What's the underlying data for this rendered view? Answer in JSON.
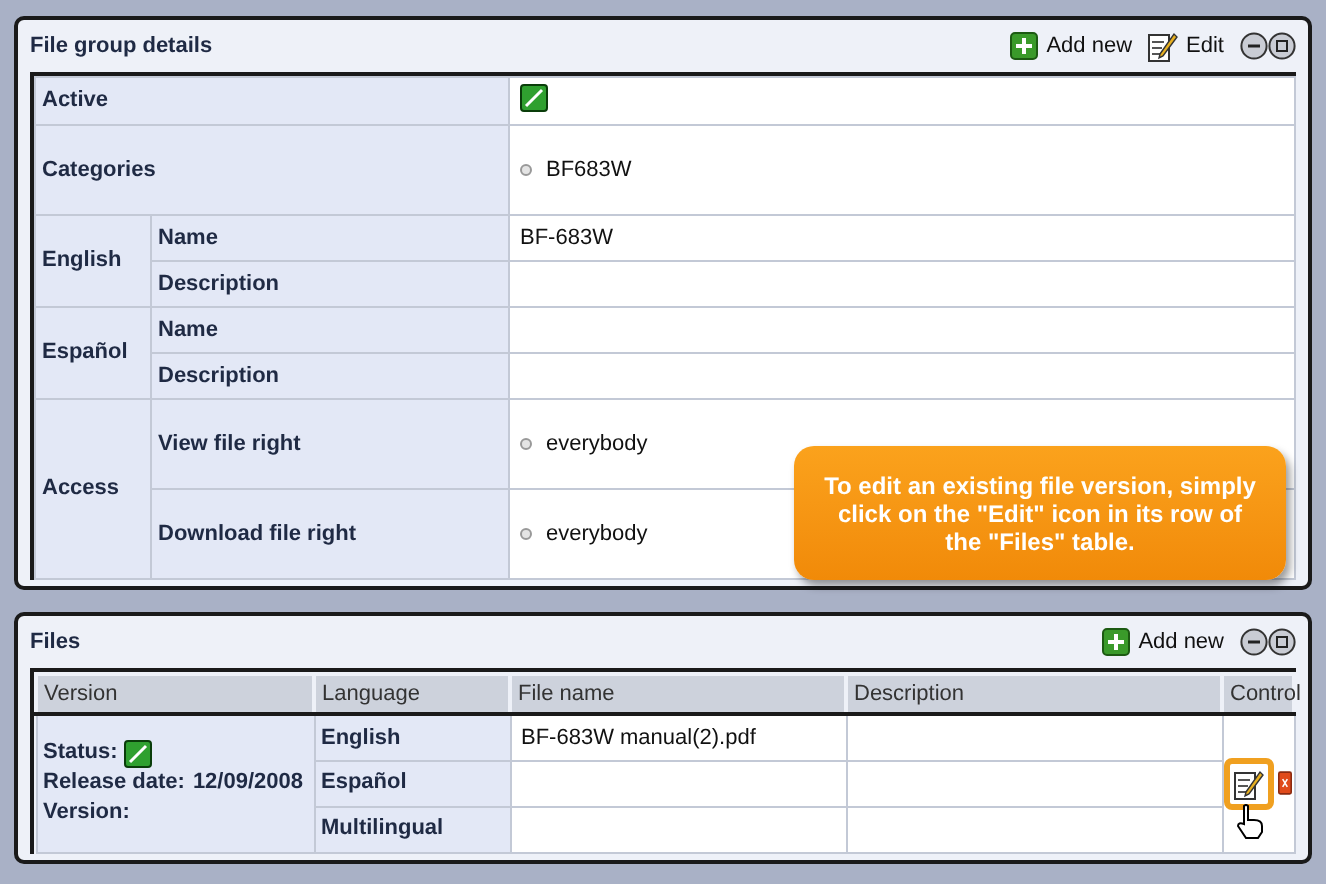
{
  "details": {
    "title": "File group details",
    "actions": [
      {
        "kind": "add",
        "label": "Add new"
      },
      {
        "kind": "edit",
        "label": "Edit"
      }
    ],
    "rows": [
      {
        "kind": "checkbox",
        "label": "Active",
        "checked": true
      },
      {
        "kind": "bullet",
        "label": "Categories",
        "value": "BF683W"
      },
      {
        "kind": "group",
        "label": "English",
        "fields": [
          {
            "kind": "text",
            "label": "Name",
            "value": "BF-683W"
          },
          {
            "kind": "text",
            "label": "Description"
          }
        ]
      },
      {
        "kind": "group",
        "label": "Español",
        "fields": [
          {
            "kind": "text",
            "label": "Name"
          },
          {
            "kind": "text",
            "label": "Description"
          }
        ]
      },
      {
        "kind": "group",
        "label": "Access",
        "fields": [
          {
            "kind": "bullet",
            "label": "View file right",
            "value": "everybody"
          },
          {
            "kind": "bullet",
            "label": "Download file right",
            "value": "everybody"
          }
        ]
      }
    ]
  },
  "callout": "To edit an existing file version, simply click on the \"Edit\" icon in its row of the \"Files\" table.",
  "files": {
    "title": "Files",
    "actions": [
      {
        "kind": "add",
        "label": "Add new"
      }
    ],
    "columns": [
      "Version",
      "Language",
      "File name",
      "Description",
      "Control"
    ],
    "version": {
      "status_label": "Status:",
      "status_checked": true,
      "release_label": "Release date:",
      "release_date": "12/09/2008",
      "version_label": "Version:"
    },
    "rows": [
      {
        "language": "English",
        "file_name": "BF-683W manual(2).pdf"
      },
      {
        "language": "Español"
      },
      {
        "language": "Multilingual"
      }
    ],
    "control_highlighted": true
  }
}
